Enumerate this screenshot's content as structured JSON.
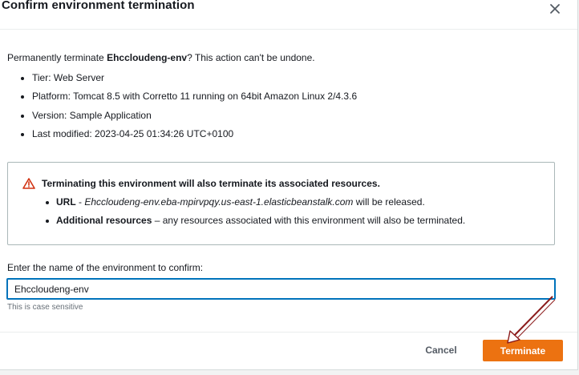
{
  "dialog": {
    "title": "Confirm environment termination",
    "close_icon": "close-icon"
  },
  "intro": {
    "prefix": "Permanently terminate ",
    "env_name": "Ehccloudeng-env",
    "suffix": "? This action can't be undone."
  },
  "details": [
    "Tier: Web Server",
    "Platform: Tomcat 8.5 with Corretto 11 running on 64bit Amazon Linux 2/4.3.6",
    "Version: Sample Application",
    "Last modified: 2023-04-25 01:34:26 UTC+0100"
  ],
  "warning": {
    "icon": "warning-icon",
    "icon_color": "#d13212",
    "heading": "Terminating this environment will also terminate its associated resources.",
    "items": [
      {
        "label": "URL",
        "separator": " - ",
        "value": "Ehccloudeng-env.eba-mpirvpqy.us-east-1.elasticbeanstalk.com",
        "suffix": " will be released."
      },
      {
        "label": "Additional resources",
        "separator": " – ",
        "value": "",
        "suffix": "any resources associated with this environment will also be terminated."
      }
    ]
  },
  "confirm": {
    "label": "Enter the name of the environment to confirm:",
    "value": "Ehccloudeng-env",
    "hint": "This is case sensitive"
  },
  "buttons": {
    "cancel": "Cancel",
    "terminate": "Terminate"
  },
  "colors": {
    "accent": "#ec7211",
    "focus": "#0073bb",
    "annotation_arrow": "#8b1a1a"
  }
}
